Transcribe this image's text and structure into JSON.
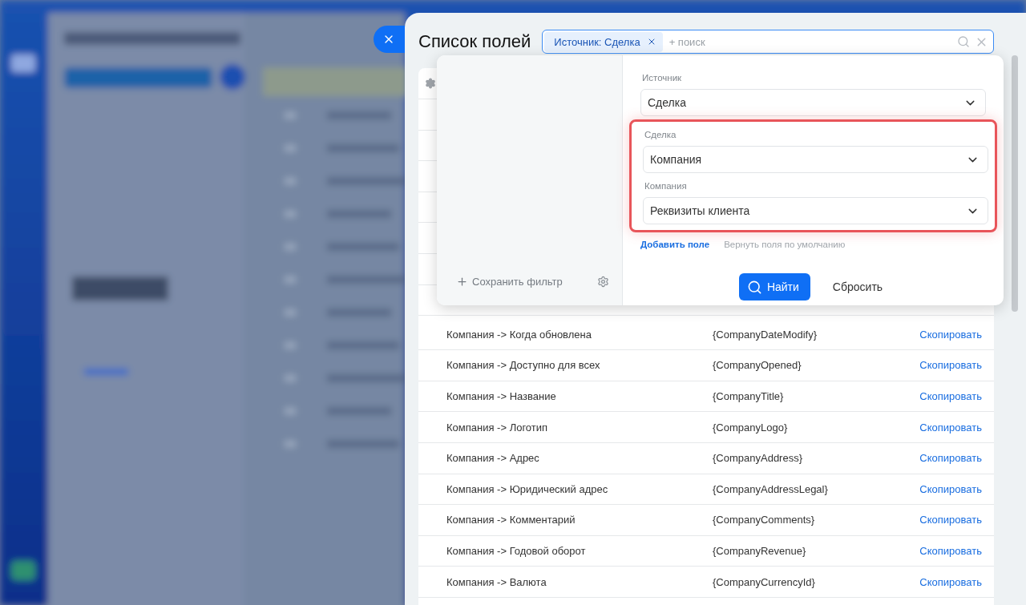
{
  "panel": {
    "title": "Список полей"
  },
  "search": {
    "chips": [
      {
        "label": "Источник: Сделка"
      }
    ],
    "placeholder": "+ поиск"
  },
  "filter_popup": {
    "save_filter": "Сохранить фильтр",
    "fields": [
      {
        "label": "Источник",
        "value": "Сделка",
        "highlighted": false
      },
      {
        "label": "Сделка",
        "value": "Компания",
        "highlighted": true
      },
      {
        "label": "Компания",
        "value": "Реквизиты клиента",
        "highlighted": true
      }
    ],
    "add_field": "Добавить поле",
    "reset_fields": "Вернуть поля по умолчанию",
    "find_button": "Найти",
    "reset_button": "Сбросить"
  },
  "table": {
    "rows": [
      {
        "field": "Компания -> Когда обновлена",
        "code": "{CompanyDateModify}",
        "action": "Скопировать"
      },
      {
        "field": "Компания -> Доступно для всех",
        "code": "{CompanyOpened}",
        "action": "Скопировать"
      },
      {
        "field": "Компания -> Название",
        "code": "{CompanyTitle}",
        "action": "Скопировать"
      },
      {
        "field": "Компания -> Логотип",
        "code": "{CompanyLogo}",
        "action": "Скопировать"
      },
      {
        "field": "Компания -> Адрес",
        "code": "{CompanyAddress}",
        "action": "Скопировать"
      },
      {
        "field": "Компания -> Юридический адрес",
        "code": "{CompanyAddressLegal}",
        "action": "Скопировать"
      },
      {
        "field": "Компания -> Комментарий",
        "code": "{CompanyComments}",
        "action": "Скопировать"
      },
      {
        "field": "Компания -> Годовой оборот",
        "code": "{CompanyRevenue}",
        "action": "Скопировать"
      },
      {
        "field": "Компания -> Валюта",
        "code": "{CompanyCurrencyId}",
        "action": "Скопировать"
      }
    ]
  }
}
